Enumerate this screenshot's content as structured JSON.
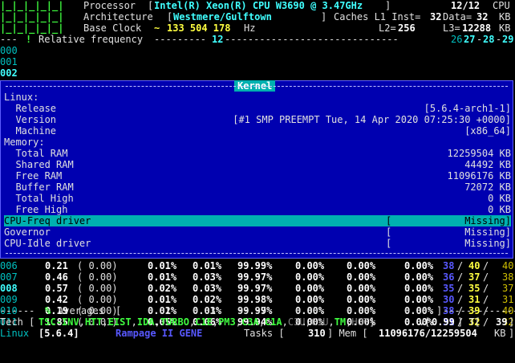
{
  "header": {
    "bars": "|_|_|_|_|_|",
    "processor_label": "Processor",
    "processor_value": "Intel(R) Xeon(R) CPU W3690 @ 3.47GHz",
    "cpu_count": "12/12",
    "cpu_label": "CPU",
    "bars2": "|_|_|_|_|_|",
    "arch_label": "Architecture",
    "arch_value": "Westmere/Gulftown",
    "caches_label": "Caches L1 Inst=",
    "l1_inst": "32",
    "data_label": "Data=",
    "l1_data": "32",
    "kb1": "KB",
    "bars3": "|_|_|_|_|_|",
    "clock_label": "Base Clock",
    "clock_tilde": "~",
    "clock_value": "133 504 178",
    "hz": "Hz",
    "l2_label": "L2=",
    "l2": "256",
    "l3_label": "L3=",
    "l3": "12288",
    "kb2": "KB",
    "freq_dashes": "--- ",
    "freq_bang": "!",
    "freq_label": "Relative frequency",
    "freq_fill": "---------",
    "freq_12": "12",
    "freq_fill2": "------------------------------",
    "freq_26": "26",
    "freq_27": "27",
    "freq_28": "28",
    "freq_29": "29"
  },
  "top_cores": [
    "000",
    "001",
    "002"
  ],
  "kernel": {
    "title": "Kernel",
    "linux_label": "Linux:",
    "rows": [
      {
        "label": "  Release",
        "value": "[5.6.4-arch1-1]"
      },
      {
        "label": "  Version",
        "value": "[#1 SMP PREEMPT Tue, 14 Apr 2020 07:25:30 +0000]"
      },
      {
        "label": "  Machine",
        "value": "[x86_64]"
      }
    ],
    "memory_label": "Memory:",
    "mem_rows": [
      {
        "label": "  Total RAM",
        "value": "12259504 KB"
      },
      {
        "label": "  Shared RAM",
        "value": "44492 KB"
      },
      {
        "label": "  Free RAM",
        "value": "11096176 KB"
      },
      {
        "label": "  Buffer RAM",
        "value": "72072 KB"
      },
      {
        "label": "  Total High",
        "value": "0 KB"
      },
      {
        "label": "  Free High",
        "value": "0 KB"
      }
    ],
    "drivers": [
      {
        "label": "CPU-Freq driver",
        "bracket": "[",
        "value": "Missing]"
      },
      {
        "label": "Governor",
        "bracket": "[",
        "value": "Missing]"
      },
      {
        "label": "CPU-Idle driver",
        "bracket": "[",
        "value": "Missing]"
      }
    ]
  },
  "cores": [
    {
      "id": "006",
      "ratio": "0.21",
      "c0": "( 0.00)",
      "p1": "0.01%",
      "p2": "0.01%",
      "p3": "99.99%",
      "p4": "0.00%",
      "p5": "0.00%",
      "p6": "0.00%",
      "t1": "38",
      "t2": "40",
      "t3": "40"
    },
    {
      "id": "007",
      "ratio": "0.46",
      "c0": "( 0.00)",
      "p1": "0.01%",
      "p2": "0.03%",
      "p3": "99.97%",
      "p4": "0.00%",
      "p5": "0.00%",
      "p6": "0.00%",
      "t1": "36",
      "t2": "37",
      "t3": "38"
    },
    {
      "id": "008",
      "ratio": "0.57",
      "c0": "( 0.00)",
      "p1": "0.02%",
      "p2": "0.03%",
      "p3": "99.97%",
      "p4": "0.00%",
      "p5": "0.00%",
      "p6": "0.00%",
      "t1": "35",
      "t2": "35",
      "t3": "37"
    },
    {
      "id": "009",
      "ratio": "0.42",
      "c0": "( 0.00)",
      "p1": "0.01%",
      "p2": "0.02%",
      "p3": "99.98%",
      "p4": "0.00%",
      "p5": "0.00%",
      "p6": "0.00%",
      "t1": "30",
      "t2": "31",
      "t3": "31"
    },
    {
      "id": "010",
      "ratio": "0.19",
      "c0": "( 0.00)",
      "p1": "0.01%",
      "p2": "0.01%",
      "p3": "99.99%",
      "p4": "0.00%",
      "p5": "0.00%",
      "p6": "0.00%",
      "t1": "38",
      "t2": "39",
      "t3": "40"
    },
    {
      "id": "011",
      "ratio": "1.85",
      "c0": "( 0.01)",
      "p1": "0.05%",
      "p2": "0.06%",
      "p3": "99.94%",
      "p4": "0.00%",
      "p5": "0.00%",
      "p6": "0.00%",
      "t1": "31",
      "t2": "32",
      "t3": "32"
    }
  ],
  "averages": {
    "dashes": "------",
    "pct": "%",
    "label": "Averages",
    "ob": "[",
    "p1": "0.02%",
    "p2": "0.03%",
    "p3": "99.97%",
    "p4": "0.00%",
    "p5": "0.00%",
    "p6": "0.00%",
    "cb": "]",
    "tail": "-------------"
  },
  "tech": {
    "label": "Tech [",
    "flags_on": [
      "TSC-INV",
      "HTT",
      "EIST",
      "IDA",
      "TURBO",
      "C1E",
      "PM3",
      "C3A",
      "C1A"
    ],
    "flags_off": [
      "C3U",
      "C1U"
    ],
    "flag_tm": "TM",
    "flag_hot": "HOT",
    "close": "]",
    "v_label": "V[",
    "v_value": "0.99",
    "t_label": "] T[",
    "t_value": "39",
    "t_close": "]"
  },
  "status": {
    "os": "Linux",
    "kernel": "[5.6.4]",
    "board": "Rampage II GENE",
    "tasks_label": "Tasks [",
    "tasks": "310",
    "mem_label": "] Mem [",
    "mem": "11096176/12259504",
    "mem_unit": "KB",
    "close": "]"
  },
  "colors": {
    "background": "#000000",
    "kernel_bg": "#0000b0",
    "highlight": "#00b0b0",
    "accent_green": "#40ff40",
    "accent_cyan": "#40ffff",
    "accent_blue": "#5858ff"
  }
}
